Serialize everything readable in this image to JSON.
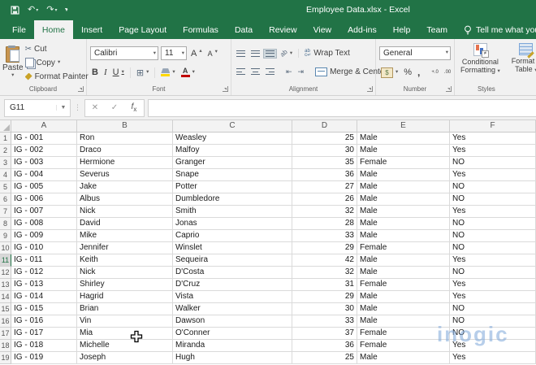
{
  "titlebar": {
    "title": "Employee Data.xlsx  -  Excel"
  },
  "tabs": {
    "items": [
      "File",
      "Home",
      "Insert",
      "Page Layout",
      "Formulas",
      "Data",
      "Review",
      "View",
      "Add-ins",
      "Help",
      "Team"
    ],
    "active": "Home",
    "tell_me": "Tell me what you want to do"
  },
  "ribbon": {
    "clipboard": {
      "label": "Clipboard",
      "paste": "Paste",
      "cut": "Cut",
      "copy": "Copy",
      "format_painter": "Format Painter"
    },
    "font": {
      "label": "Font",
      "name": "Calibri",
      "size": "11",
      "bold": "B",
      "italic": "I",
      "underline": "U",
      "grow": "A",
      "shrink": "A"
    },
    "alignment": {
      "label": "Alignment",
      "wrap_text": "Wrap Text",
      "merge_center": "Merge & Center"
    },
    "number": {
      "label": "Number",
      "format": "General",
      "percent": "%",
      "comma": ",",
      "inc_decimal": "+.0",
      "dec_decimal": ".00"
    },
    "styles": {
      "label": "Styles",
      "conditional_line1": "Conditional",
      "conditional_line2": "Formatting",
      "table_line1": "Format a",
      "table_line2": "Table"
    }
  },
  "formula_bar": {
    "name_box": "G11",
    "value": "",
    "cancel": "✕",
    "enter": "✓",
    "fx": "fx"
  },
  "sheet": {
    "column_headers": [
      "A",
      "B",
      "C",
      "D",
      "E",
      "F"
    ],
    "active_row": 11,
    "rows": [
      {
        "n": 1,
        "id": "IG - 001",
        "first": "Ron",
        "last": "Weasley",
        "age": 25,
        "gender": "Male",
        "flag": "Yes"
      },
      {
        "n": 2,
        "id": "IG - 002",
        "first": "Draco",
        "last": "Malfoy",
        "age": 30,
        "gender": "Male",
        "flag": "Yes"
      },
      {
        "n": 3,
        "id": "IG - 003",
        "first": "Hermione",
        "last": "Granger",
        "age": 35,
        "gender": "Female",
        "flag": "NO"
      },
      {
        "n": 4,
        "id": "IG - 004",
        "first": "Severus",
        "last": "Snape",
        "age": 36,
        "gender": "Male",
        "flag": "Yes"
      },
      {
        "n": 5,
        "id": "IG - 005",
        "first": "Jake",
        "last": "Potter",
        "age": 27,
        "gender": "Male",
        "flag": "NO"
      },
      {
        "n": 6,
        "id": "IG - 006",
        "first": "Albus",
        "last": "Dumbledore",
        "age": 26,
        "gender": "Male",
        "flag": "NO"
      },
      {
        "n": 7,
        "id": "IG - 007",
        "first": "Nick",
        "last": "Smith",
        "age": 32,
        "gender": "Male",
        "flag": "Yes"
      },
      {
        "n": 8,
        "id": "IG - 008",
        "first": "David",
        "last": "Jonas",
        "age": 28,
        "gender": "Male",
        "flag": "NO"
      },
      {
        "n": 9,
        "id": "IG - 009",
        "first": "Mike",
        "last": "Caprio",
        "age": 33,
        "gender": "Male",
        "flag": "NO"
      },
      {
        "n": 10,
        "id": "IG - 010",
        "first": "Jennifer",
        "last": "Winslet",
        "age": 29,
        "gender": "Female",
        "flag": "NO"
      },
      {
        "n": 11,
        "id": "IG - 011",
        "first": "Keith",
        "last": "Sequeira",
        "age": 42,
        "gender": "Male",
        "flag": "Yes"
      },
      {
        "n": 12,
        "id": "IG - 012",
        "first": "Nick",
        "last": "D'Costa",
        "age": 32,
        "gender": "Male",
        "flag": "NO"
      },
      {
        "n": 13,
        "id": "IG - 013",
        "first": "Shirley",
        "last": "D'Cruz",
        "age": 31,
        "gender": "Female",
        "flag": "Yes"
      },
      {
        "n": 14,
        "id": "IG - 014",
        "first": "Hagrid",
        "last": "Vista",
        "age": 29,
        "gender": "Male",
        "flag": "Yes"
      },
      {
        "n": 15,
        "id": "IG - 015",
        "first": "Brian",
        "last": "Walker",
        "age": 30,
        "gender": "Male",
        "flag": "NO"
      },
      {
        "n": 16,
        "id": "IG - 016",
        "first": "Vin",
        "last": "Dawson",
        "age": 33,
        "gender": "Male",
        "flag": "NO"
      },
      {
        "n": 17,
        "id": "IG - 017",
        "first": "Mia",
        "last": "O'Conner",
        "age": 37,
        "gender": "Female",
        "flag": "NO"
      },
      {
        "n": 18,
        "id": "IG - 018",
        "first": "Michelle",
        "last": "Miranda",
        "age": 36,
        "gender": "Female",
        "flag": "Yes"
      },
      {
        "n": 19,
        "id": "IG - 019",
        "first": "Joseph",
        "last": "Hugh",
        "age": 25,
        "gender": "Male",
        "flag": "Yes"
      }
    ]
  },
  "watermark": {
    "text": "inogic",
    "color": "#7da7d9"
  },
  "colors": {
    "excel_green": "#217346",
    "ribbon_bg": "#f1f1f1",
    "gridline": "#dadada"
  }
}
